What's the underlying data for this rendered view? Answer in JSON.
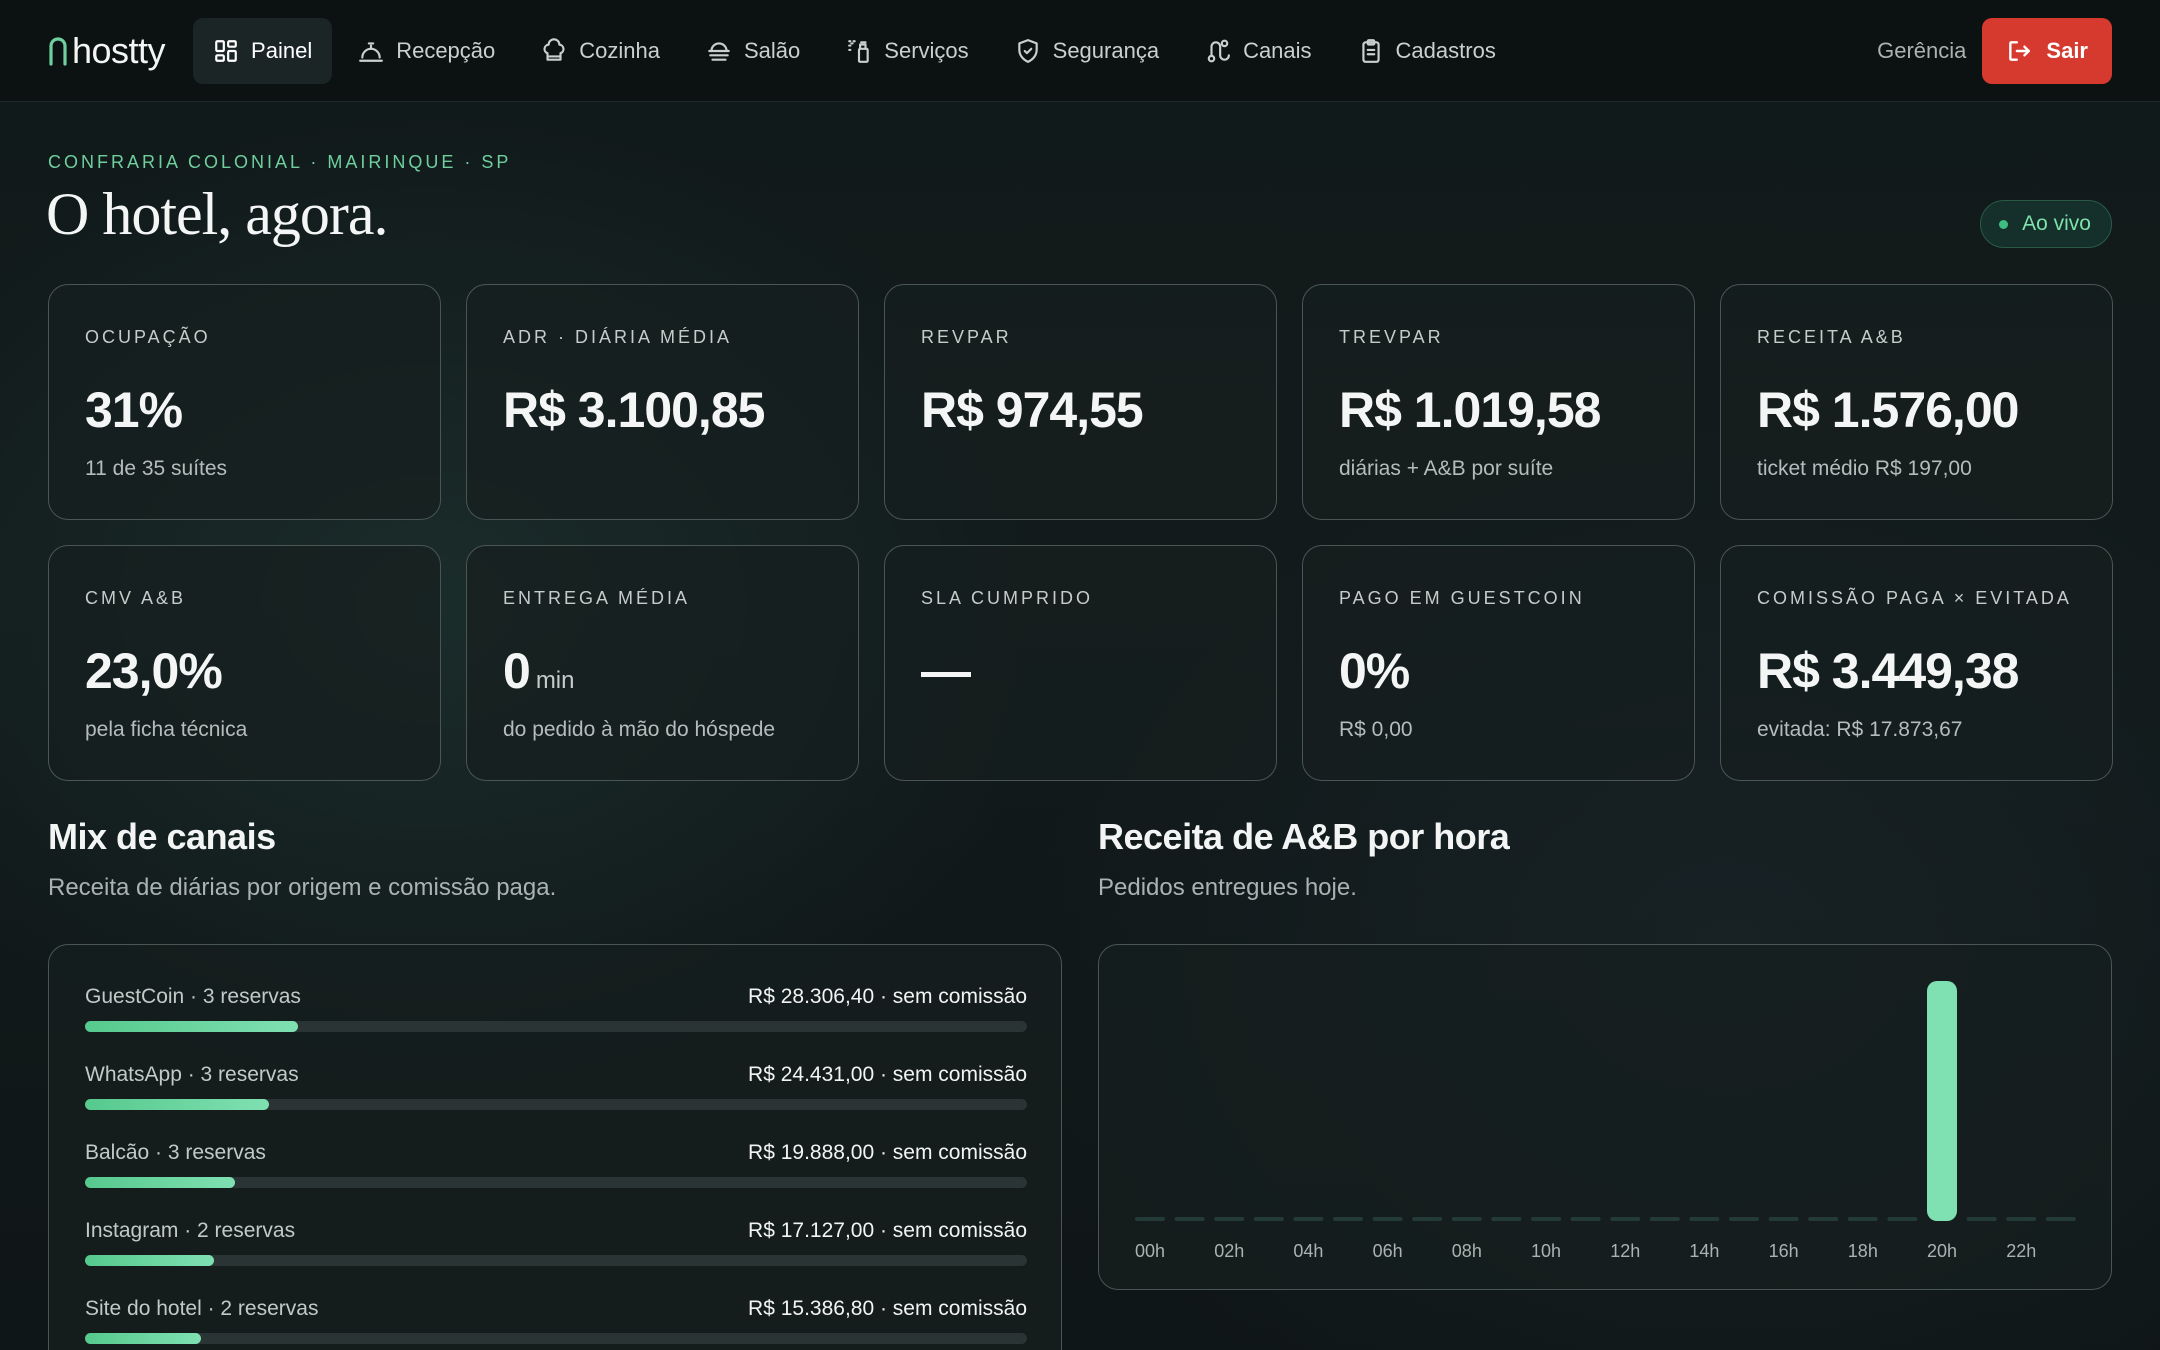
{
  "app": {
    "brand": "hostty"
  },
  "nav": {
    "items": [
      {
        "label": "Painel",
        "icon": "dashboard-icon",
        "active": true
      },
      {
        "label": "Recepção",
        "icon": "bell-icon",
        "active": false
      },
      {
        "label": "Cozinha",
        "icon": "chef-hat-icon",
        "active": false
      },
      {
        "label": "Salão",
        "icon": "dish-icon",
        "active": false
      },
      {
        "label": "Serviços",
        "icon": "spray-icon",
        "active": false
      },
      {
        "label": "Segurança",
        "icon": "shield-icon",
        "active": false
      },
      {
        "label": "Canais",
        "icon": "route-icon",
        "active": false
      },
      {
        "label": "Cadastros",
        "icon": "clipboard-icon",
        "active": false
      }
    ],
    "role": "Gerência",
    "logout_label": "Sair"
  },
  "header": {
    "eyebrow": "CONFRARIA COLONIAL · MAIRINQUE · SP",
    "title": "O hotel, agora.",
    "live_label": "Ao vivo"
  },
  "kpis": [
    {
      "label": "OCUPAÇÃO",
      "value": "31%",
      "unit": "",
      "sub": "11 de 35 suítes"
    },
    {
      "label": "ADR · DIÁRIA MÉDIA",
      "value": "R$ 3.100,85",
      "unit": "",
      "sub": ""
    },
    {
      "label": "REVPAR",
      "value": "R$ 974,55",
      "unit": "",
      "sub": ""
    },
    {
      "label": "TREVPAR",
      "value": "R$ 1.019,58",
      "unit": "",
      "sub": "diárias + A&B por suíte"
    },
    {
      "label": "RECEITA A&B",
      "value": "R$ 1.576,00",
      "unit": "",
      "sub": "ticket médio R$ 197,00"
    },
    {
      "label": "CMV A&B",
      "value": "23,0%",
      "unit": "",
      "sub": "pela ficha técnica"
    },
    {
      "label": "ENTREGA MÉDIA",
      "value": "0",
      "unit": "min",
      "sub": "do pedido à mão do hóspede"
    },
    {
      "label": "SLA CUMPRIDO",
      "value": "—",
      "unit": "",
      "sub": ""
    },
    {
      "label": "PAGO EM GUESTCOIN",
      "value": "0%",
      "unit": "",
      "sub": "R$ 0,00"
    },
    {
      "label": "COMISSÃO PAGA × EVITADA",
      "value": "R$ 3.449,38",
      "unit": "",
      "sub": "evitada: R$ 17.873,67"
    }
  ],
  "mix": {
    "title": "Mix de canais",
    "subtitle": "Receita de diárias por origem e comissão paga.",
    "rows": [
      {
        "name": "GuestCoin · 3 reservas",
        "value": "R$ 28.306,40 · sem comissão",
        "share": 0.226
      },
      {
        "name": "WhatsApp · 3 reservas",
        "value": "R$ 24.431,00 · sem comissão",
        "share": 0.195
      },
      {
        "name": "Balcão · 3 reservas",
        "value": "R$ 19.888,00 · sem comissão",
        "share": 0.159
      },
      {
        "name": "Instagram · 2 reservas",
        "value": "R$ 17.127,00 · sem comissão",
        "share": 0.137
      },
      {
        "name": "Site do hotel · 2 reservas",
        "value": "R$ 15.386,80 · sem comissão",
        "share": 0.123
      }
    ]
  },
  "revenue_chart": {
    "title": "Receita de A&B por hora",
    "subtitle": "Pedidos entregues hoje."
  },
  "chart_data": {
    "type": "bar",
    "categories": [
      "00h",
      "01h",
      "02h",
      "03h",
      "04h",
      "05h",
      "06h",
      "07h",
      "08h",
      "09h",
      "10h",
      "11h",
      "12h",
      "13h",
      "14h",
      "15h",
      "16h",
      "17h",
      "18h",
      "19h",
      "20h",
      "21h",
      "22h",
      "23h"
    ],
    "tick_labels": [
      "00h",
      "02h",
      "04h",
      "06h",
      "08h",
      "10h",
      "12h",
      "14h",
      "16h",
      "18h",
      "20h",
      "22h"
    ],
    "values": [
      0,
      0,
      0,
      0,
      0,
      0,
      0,
      0,
      0,
      0,
      0,
      0,
      0,
      0,
      0,
      0,
      0,
      0,
      0,
      0,
      1576,
      0,
      0,
      0
    ],
    "ylim": [
      0,
      1576
    ],
    "colors": {
      "bar": "#7fe0b2",
      "empty_bar": "#243a36"
    }
  }
}
